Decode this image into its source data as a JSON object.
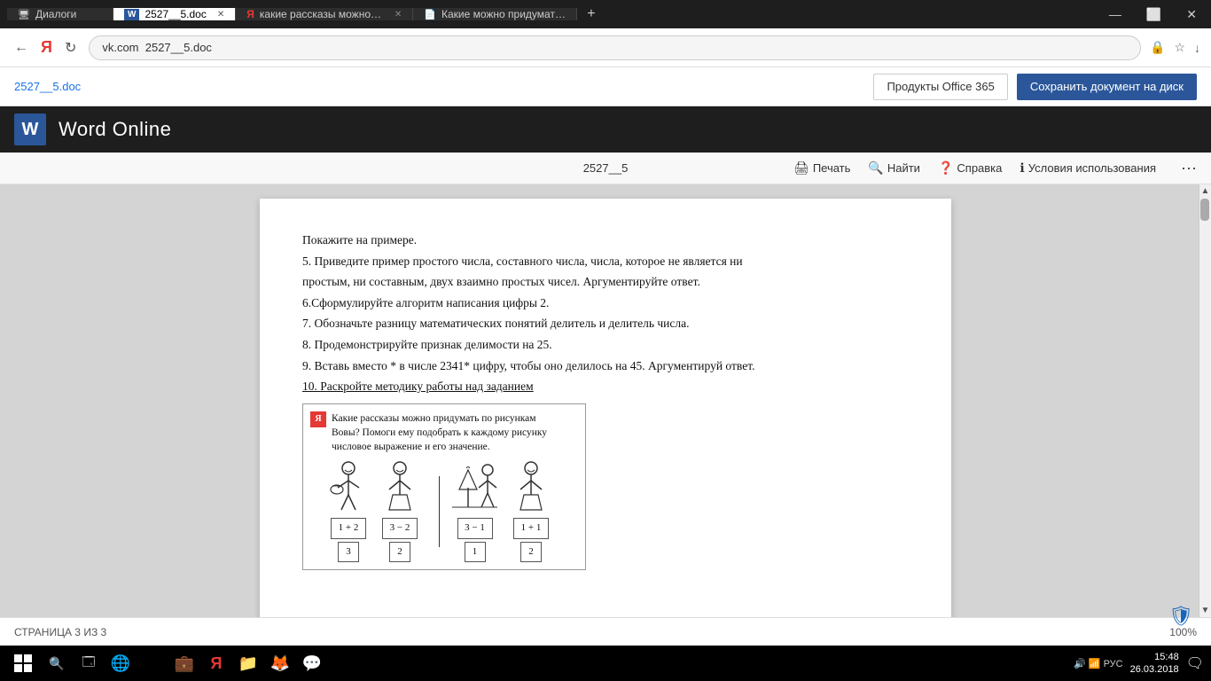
{
  "titlebar": {
    "tabs": [
      {
        "label": "Диалоги",
        "icon": "🖥",
        "active": false,
        "closable": false
      },
      {
        "label": "2527__5.doc",
        "icon": "W",
        "active": true,
        "closable": true
      },
      {
        "label": "какие рассказы можно пр...",
        "icon": "Я",
        "active": false,
        "closable": true
      },
      {
        "label": "Какие можно придумать во...",
        "icon": "📄",
        "active": false,
        "closable": false
      }
    ],
    "win_buttons": [
      "—",
      "⬜",
      "✕"
    ]
  },
  "addressbar": {
    "back": "←",
    "yandex_icon": "Я",
    "reload": "↻",
    "url": "vk.com  2527__5.doc",
    "lock_icon": "🔒",
    "star_icon": "★",
    "download_icon": "↓"
  },
  "doctoolbar": {
    "doc_name": "2527__5.doc",
    "btn_office": "Продукты Office 365",
    "btn_save": "Сохранить документ на диск"
  },
  "word_header": {
    "logo": "W",
    "title": "Word Online"
  },
  "doc_actions": {
    "doc_id": "2527__5",
    "print": "Печать",
    "find": "Найти",
    "help": "Справка",
    "terms": "Условия использования",
    "more": "···"
  },
  "document": {
    "lines": [
      {
        "id": 1,
        "text": "Покажите на примере.",
        "underline": false
      },
      {
        "id": 2,
        "text": "5.  Приведите пример простого числа, составного числа, числа, которое не является ни",
        "underline": false
      },
      {
        "id": 3,
        "text": "простым, ни составным, двух взаимно простых чисел. Аргументируйте ответ.",
        "underline": false
      },
      {
        "id": 4,
        "text": "6.Сформулируйте алгоритм написания цифры 2.",
        "underline": false
      },
      {
        "id": 5,
        "text": "7.  Обозначьте разницу  математических понятий делитель и делитель числа.",
        "underline": false
      },
      {
        "id": 6,
        "text": "8. Продемонстрируйте признак делимости на 25.",
        "underline": false
      },
      {
        "id": 7,
        "text": "9. Вставь вместо * в числе 2341* цифру, чтобы оно делилось на 45. Аргументируй ответ.",
        "underline": false
      },
      {
        "id": 8,
        "text": "10. Раскройте методику работы над заданием",
        "underline": true
      }
    ],
    "image": {
      "header_text": "Какие рассказы можно придумать по рисункам Вовы? Помоги ему подобрать к каждому рисунку числовое выражение и его значение.",
      "figures": [
        {
          "expr": "1 + 2",
          "result": "3"
        },
        {
          "expr": "3 − 2",
          "result": "2"
        },
        {
          "expr": "3 − 1",
          "result": "1"
        },
        {
          "expr": "1 + 1",
          "result": "2"
        }
      ]
    }
  },
  "statusbar": {
    "page_info": "СТРАНИЦА 3 ИЗ 3",
    "zoom": "100%",
    "shield": "🛡"
  },
  "taskbar": {
    "start_icon": "⊞",
    "apps": [
      "🔍",
      "🗔",
      "📧",
      "💼",
      "Я",
      "📁",
      "🦊",
      "📞"
    ],
    "time": "15:48",
    "date": "26.03.2018",
    "sys_icons": "🔊  📶  РУС"
  }
}
